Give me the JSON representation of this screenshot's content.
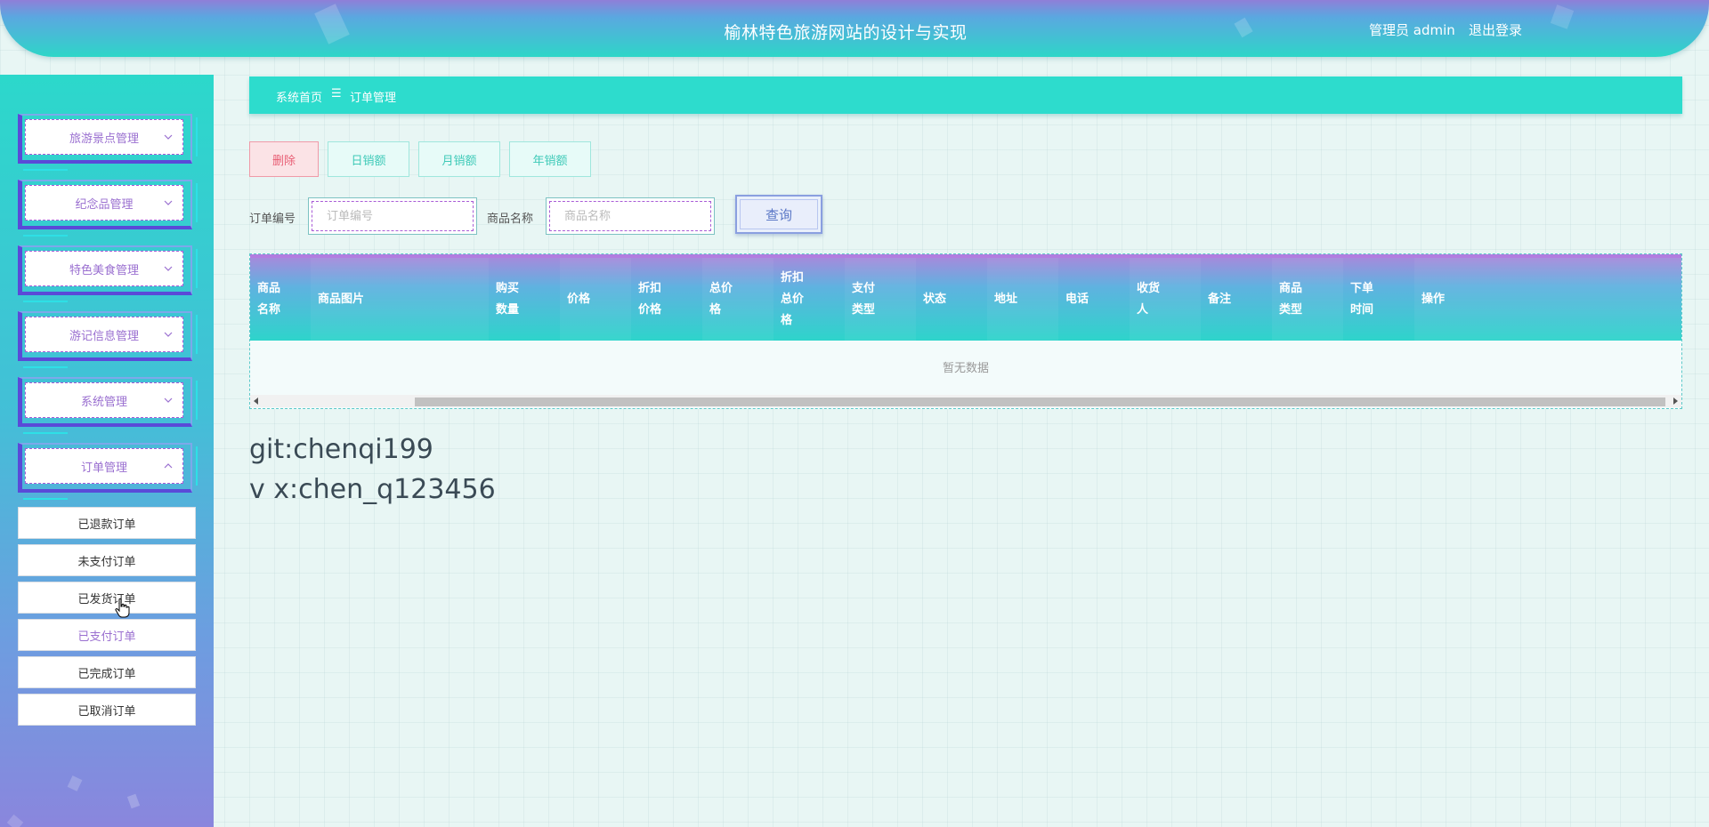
{
  "header": {
    "title": "榆林特色旅游网站的设计与实现",
    "user": "管理员 admin",
    "logout": "退出登录"
  },
  "sidebar": {
    "menu": [
      {
        "label": "旅游景点管理",
        "expanded": false
      },
      {
        "label": "纪念品管理",
        "expanded": false
      },
      {
        "label": "特色美食管理",
        "expanded": false
      },
      {
        "label": "游记信息管理",
        "expanded": false
      },
      {
        "label": "系统管理",
        "expanded": false
      },
      {
        "label": "订单管理",
        "expanded": true
      }
    ],
    "submenu": [
      {
        "label": "已退款订单"
      },
      {
        "label": "未支付订单"
      },
      {
        "label": "已发货订单"
      },
      {
        "label": "已支付订单",
        "active": true
      },
      {
        "label": "已完成订单"
      },
      {
        "label": "已取消订单"
      }
    ]
  },
  "breadcrumb": {
    "home": "系统首页",
    "separator": "☰",
    "current": "订单管理"
  },
  "actions": {
    "delete": "删除",
    "daily": "日销额",
    "monthly": "月销额",
    "yearly": "年销额"
  },
  "search": {
    "order_label": "订单编号",
    "order_placeholder": "订单编号",
    "product_label": "商品名称",
    "product_placeholder": "商品名称",
    "query": "查询"
  },
  "table": {
    "columns": [
      "商品\n名称",
      "商品图片",
      "购买\n数量",
      "价格",
      "折扣\n价格",
      "总价\n格",
      "折扣\n总价\n格",
      "支付\n类型",
      "状态",
      "地址",
      "电话",
      "收货\n人",
      "备注",
      "商品\n类型",
      "下单\n时间",
      "操作"
    ],
    "empty_text": "暂无数据"
  },
  "watermark": {
    "line1": "git:chenqi199",
    "line2": "v x:chen_q123456"
  },
  "colors": {
    "accent": "#2ddccd",
    "purple": "#9a6fd0",
    "delete": "#e85e74"
  }
}
